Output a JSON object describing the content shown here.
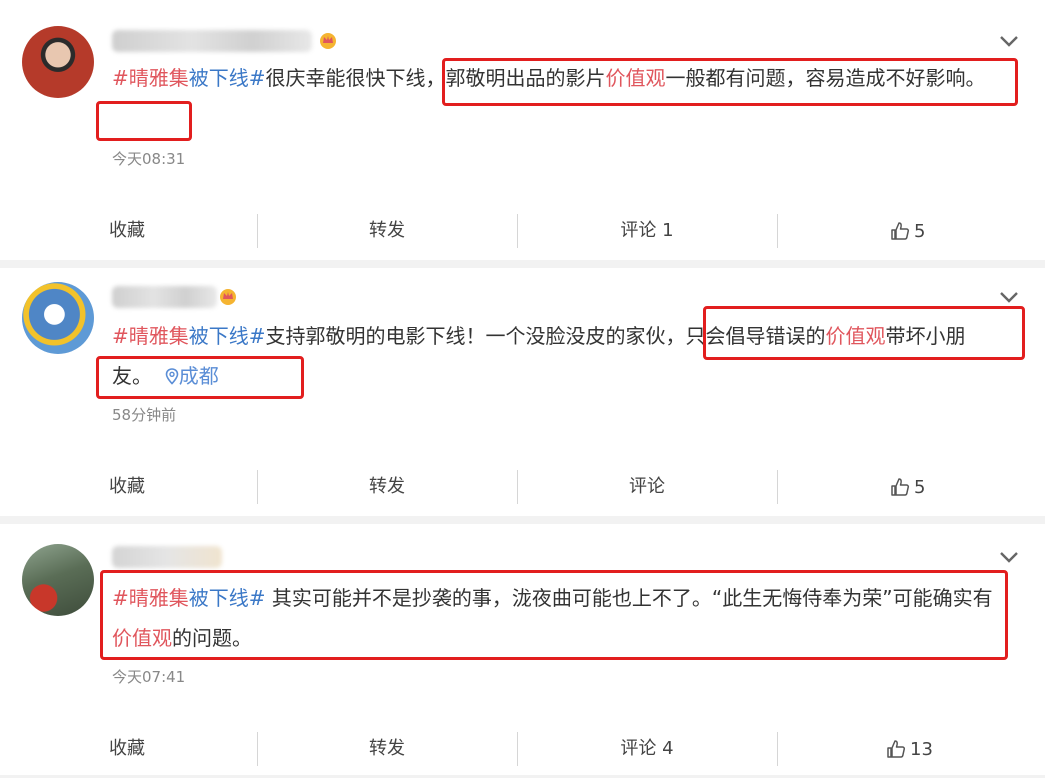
{
  "posts": [
    {
      "hashtag_a": "#晴雅集",
      "hashtag_b": "被下线#",
      "text_before": "很庆幸能很快下线，",
      "text_highlight_pre": "郭敬明出品的影片",
      "keyword": "价值观",
      "text_highlight_post": "一般都有问题，容易造成不好影响。",
      "location": "",
      "timestamp": "今天08:31",
      "actions": {
        "collect": "收藏",
        "repost": "转发",
        "comment": "评论 1",
        "likes": "5"
      }
    },
    {
      "hashtag_a": "#晴雅集",
      "hashtag_b": "被下线#",
      "text_before": "支持郭敬明的电影下线！一个没脸没皮的家伙，",
      "text_highlight_pre": "只会倡导错误的",
      "keyword": "价值观",
      "text_highlight_post": "带坏小朋友。",
      "location": "成都",
      "timestamp": "58分钟前",
      "actions": {
        "collect": "收藏",
        "repost": "转发",
        "comment": "评论",
        "likes": "5"
      }
    },
    {
      "hashtag_a": "#晴雅集",
      "hashtag_b": "被下线#",
      "text_before": " 其实可能并不是抄袭的事，泷夜曲可能也上不了。“此生无悔侍奉为荣”可能确实有",
      "text_highlight_pre": "",
      "keyword": "价值观",
      "text_highlight_post": "的问题。",
      "location": "",
      "timestamp": "今天07:41",
      "actions": {
        "collect": "收藏",
        "repost": "转发",
        "comment": "评论 4",
        "likes": "13"
      }
    }
  ],
  "colors": {
    "hashtag": "#3b78c7",
    "keyword": "#e0565d",
    "highlight_box": "#e21e1e",
    "background": "#f2f2f2"
  },
  "icons": {
    "like": "thumbs-up-icon",
    "more": "chevron-down-icon",
    "location": "location-pin-icon",
    "vip": "crown-icon"
  }
}
